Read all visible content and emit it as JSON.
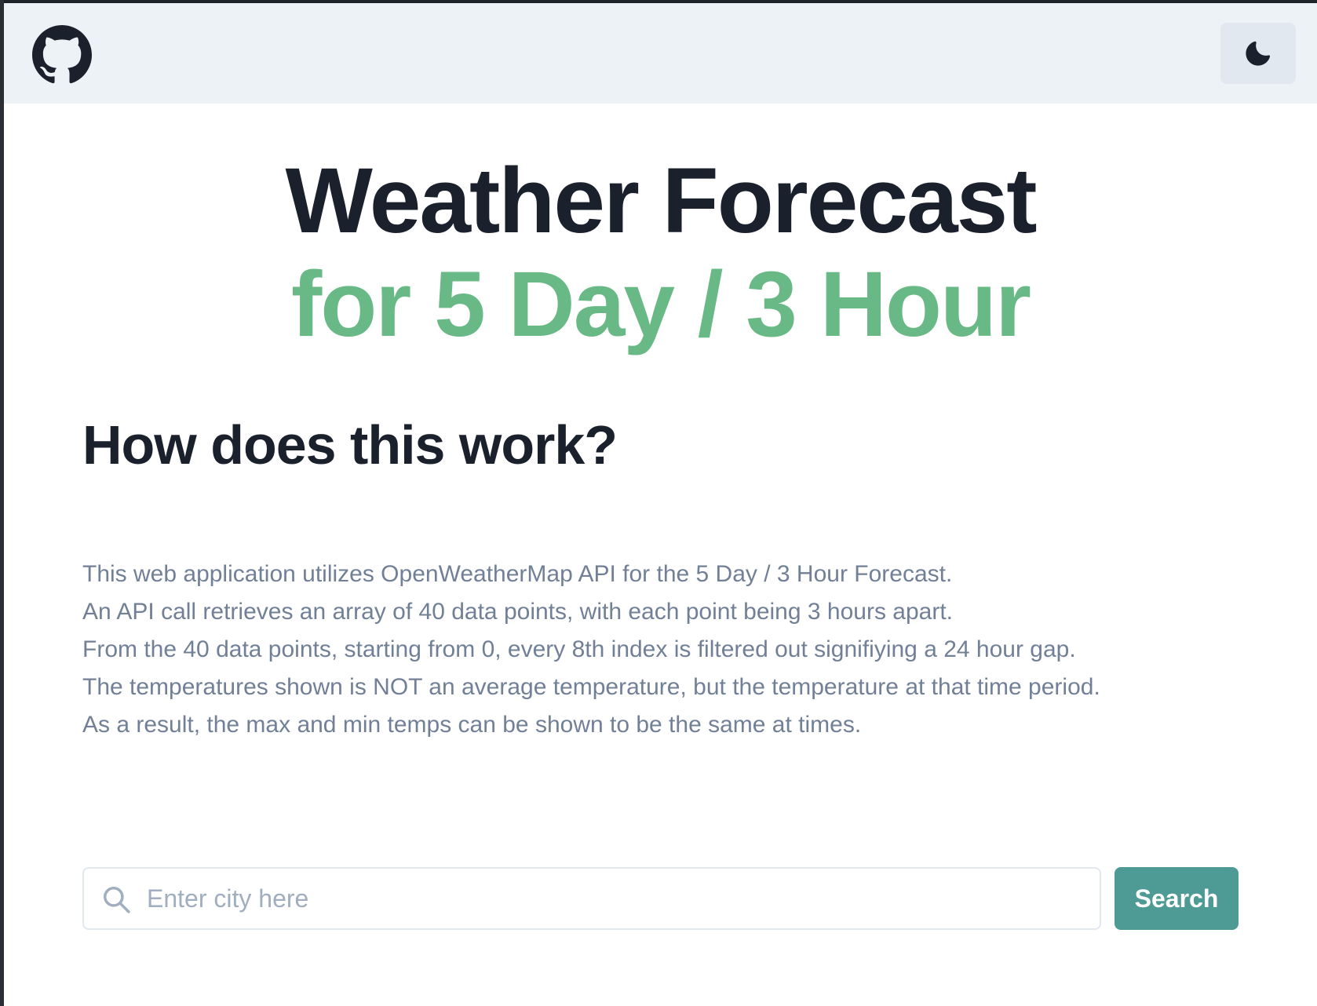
{
  "header": {
    "github_icon": "github-icon",
    "theme_toggle_icon": "moon-icon"
  },
  "hero": {
    "title_line1": "Weather Forecast",
    "title_line2": "for 5 Day / 3 Hour"
  },
  "info": {
    "heading": "How does this work?",
    "lines": [
      "This web application utilizes OpenWeatherMap API for the 5 Day / 3 Hour Forecast.",
      "An API call retrieves an array of 40 data points, with each point being 3 hours apart.",
      "From the 40 data points, starting from 0, every 8th index is filtered out signifiying a 24 hour gap.",
      "The temperatures shown is NOT an average temperature, but the temperature at that time period.",
      "As a result, the max and min temps can be shown to be the same at times."
    ]
  },
  "search": {
    "placeholder": "Enter city here",
    "value": "",
    "button_label": "Search",
    "icon": "search-icon"
  },
  "colors": {
    "accent_green": "#68b985",
    "button_teal": "#4e9a94",
    "navbar_bg": "#edf2f7",
    "heading_dark": "#1a202c",
    "body_gray": "#718096"
  }
}
